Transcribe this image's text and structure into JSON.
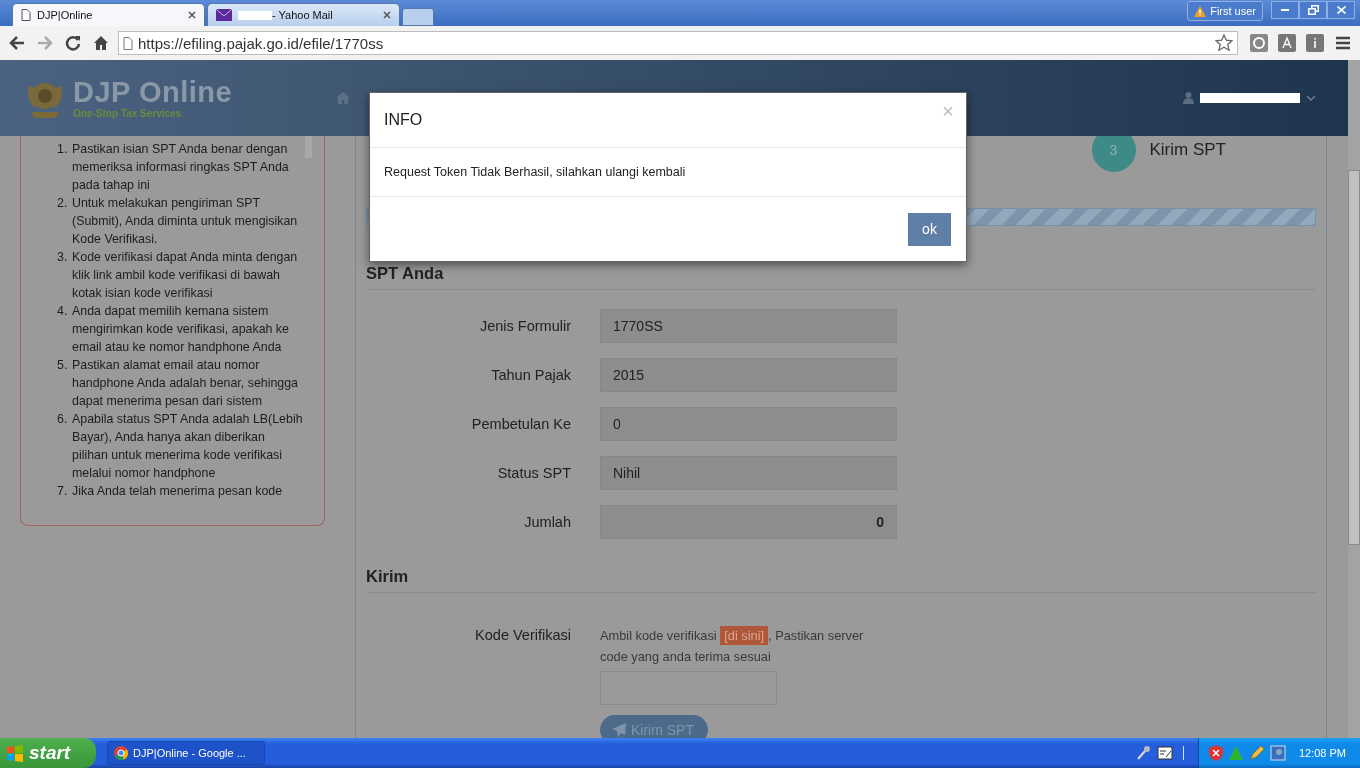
{
  "browser": {
    "tabs": [
      {
        "title": "DJP|Online",
        "kind": "page",
        "selected": true
      },
      {
        "title": "- Yahoo Mail",
        "kind": "mail",
        "selected": false
      }
    ],
    "profile": "First user",
    "url": "https://efiling.pajak.go.id/efile/1770ss"
  },
  "site": {
    "logo_title": "DJP Online",
    "logo_tagline": "One-Stop Tax Services"
  },
  "instructions": [
    {
      "number": "1.",
      "text": "Pastikan isian SPT Anda benar dengan memeriksa informasi ringkas SPT Anda pada tahap ini"
    },
    {
      "number": "2.",
      "text": "Untuk melakukan pengiriman SPT (Submit), Anda diminta untuk mengisikan Kode Verifikasi."
    },
    {
      "number": "3.",
      "text": "Kode verifikasi dapat Anda minta dengan klik link ambil kode verifikasi di bawah kotak isian kode verifikasi"
    },
    {
      "number": "4.",
      "text": "Anda dapat memilih kemana sistem mengirimkan kode verifikasi, apakah ke email atau ke nomor handphone Anda"
    },
    {
      "number": "5.",
      "text": "Pastikan alamat email atau nomor handphone Anda adalah benar, sehingga dapat menerima pesan dari sistem"
    },
    {
      "number": "6.",
      "text": "Apabila status SPT Anda adalah LB(Lebih Bayar), Anda hanya akan diberikan pilihan untuk menerima kode verifikasi melalui nomor handphone"
    },
    {
      "number": "7.",
      "text": "Jika Anda telah menerima pesan kode"
    }
  ],
  "step": {
    "number": "3",
    "label": "Kirim SPT"
  },
  "progress": {
    "level": 1
  },
  "spt_section": {
    "title": "SPT Anda",
    "fields": [
      {
        "label": "Jenis Formulir",
        "value": "1770SS",
        "kind": "text"
      },
      {
        "label": "Tahun Pajak",
        "value": "2015",
        "kind": "text"
      },
      {
        "label": "Pembetulan Ke",
        "value": "0",
        "kind": "text"
      },
      {
        "label": "Status SPT",
        "value": "Nihil",
        "kind": "text"
      },
      {
        "label": "Jumlah",
        "value": "0",
        "kind": "amount"
      }
    ]
  },
  "kirim_section": {
    "title": "Kirim",
    "label": "Kode Verifikasi",
    "hint_before": "Ambil kode verifikasi",
    "link": "[di sini]",
    "hint_after": ", Pastikan server code yang anda terima sesuai",
    "button": "Kirim SPT"
  },
  "modal": {
    "title": "INFO",
    "close": "×",
    "message": "Request Token Tidak Berhasil, silahkan ulangi kembali",
    "button": "ok"
  },
  "taskbar": {
    "start": "start",
    "tasks": [
      {
        "label": "DJP|Online - Google ..."
      }
    ],
    "clock": "12:08 PM"
  }
}
